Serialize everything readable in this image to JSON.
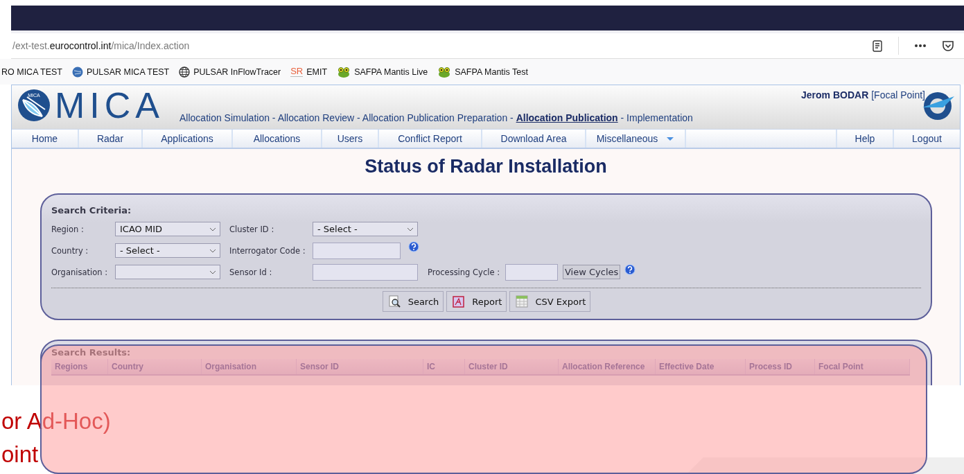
{
  "browser": {
    "url": {
      "prefix": "/ext-test.",
      "domain": "eurocontrol.int",
      "path": "/mica/Index.action"
    },
    "bookmarks": [
      {
        "label": "RO MICA TEST",
        "kind": "none"
      },
      {
        "label": "PULSAR MICA TEST",
        "kind": "globe-blue"
      },
      {
        "label": "PULSAR InFlowTracer",
        "kind": "globe"
      },
      {
        "label": "EMIT",
        "kind": "sr",
        "icon_text": "SR"
      },
      {
        "label": "SAFPA Mantis Live",
        "kind": "frog"
      },
      {
        "label": "SAFPA Mantis Test",
        "kind": "frog"
      }
    ]
  },
  "header": {
    "logo_badge": "MICA",
    "logo_text": "MICA",
    "breadcrumb": {
      "items": [
        {
          "label": "Allocation Simulation",
          "selected": false
        },
        {
          "label": "Allocation Review",
          "selected": false
        },
        {
          "label": "Allocation Publication Preparation",
          "selected": false
        },
        {
          "label": "Allocation Publication",
          "selected": true
        },
        {
          "label": "Implementation",
          "selected": false
        }
      ],
      "separators": [
        "-",
        "-",
        "-",
        "-"
      ]
    },
    "user": {
      "name": "Jerom BODAR",
      "role": "[Focal Point]"
    }
  },
  "nav": {
    "items": [
      {
        "label": "Home",
        "has_menu": false
      },
      {
        "label": "Radar",
        "has_menu": false
      },
      {
        "label": "Applications",
        "has_menu": false
      },
      {
        "label": "Allocations",
        "has_menu": false
      },
      {
        "label": "Users",
        "has_menu": false
      },
      {
        "label": "Conflict Report",
        "has_menu": false
      },
      {
        "label": "Download Area",
        "has_menu": false
      },
      {
        "label": "Miscellaneous",
        "has_menu": true
      }
    ],
    "right_items": [
      {
        "label": "Help"
      },
      {
        "label": "Logout"
      }
    ]
  },
  "page_title": "Status of Radar Installation",
  "search_criteria": {
    "title": "Search Criteria:",
    "rows": [
      [
        {
          "label": "Region :",
          "kind": "select",
          "value": "ICAO MID"
        },
        {
          "label": "Cluster ID :",
          "kind": "select",
          "value": "- Select -"
        }
      ],
      [
        {
          "label": "Country :",
          "kind": "select",
          "value": "- Select -"
        },
        {
          "label": "Interrogator Code :",
          "kind": "text",
          "help": true
        }
      ],
      [
        {
          "label": "Organisation :",
          "kind": "select"
        },
        {
          "label": "Sensor Id :",
          "kind": "text"
        },
        {
          "label": "Processing Cycle :",
          "kind": "text",
          "button": "View Cycles",
          "help": true
        }
      ]
    ],
    "buttons": [
      {
        "label": "Search",
        "kind": "search"
      },
      {
        "label": "Report",
        "kind": "report"
      },
      {
        "label": "CSV Export",
        "kind": "csv"
      }
    ]
  },
  "search_results": {
    "title": "Search Results:",
    "columns": [
      "Regions",
      "Country",
      "Organisation",
      "Sensor ID",
      "IC",
      "Cluster ID",
      "Allocation Reference",
      "Effective Date",
      "Process ID",
      "Focal Point"
    ]
  },
  "slide_text": [
    "or Ad-Hoc)",
    "oint"
  ]
}
